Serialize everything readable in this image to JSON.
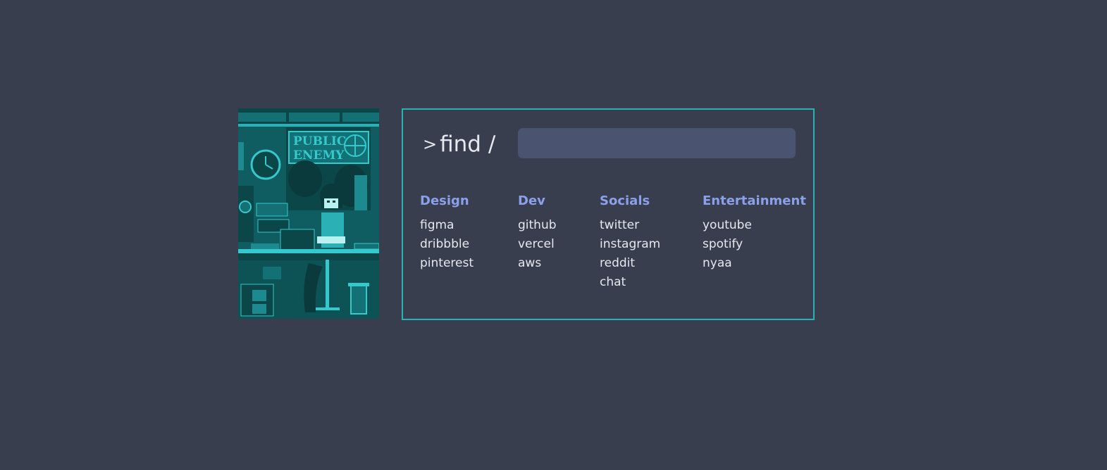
{
  "search": {
    "prompt_chevron": ">",
    "prompt_label": "find /",
    "value": "",
    "placeholder": ""
  },
  "columns": [
    {
      "title": "Design",
      "links": [
        "figma",
        "dribbble",
        "pinterest"
      ]
    },
    {
      "title": "Dev",
      "links": [
        "github",
        "vercel",
        "aws"
      ]
    },
    {
      "title": "Socials",
      "links": [
        "twitter",
        "instagram",
        "reddit",
        "chat"
      ]
    },
    {
      "title": "Entertainment",
      "links": [
        "youtube",
        "spotify",
        "nyaa"
      ]
    }
  ],
  "artwork": {
    "poster_text": [
      "PUBLIC",
      "ENEMY"
    ]
  },
  "colors": {
    "background": "#383e4d",
    "panel_border": "#2cb2b6",
    "heading": "#8aa0ea",
    "link": "#e6e8ee",
    "search_bg": "#4a5470",
    "art_teal": "#0f5d60"
  }
}
